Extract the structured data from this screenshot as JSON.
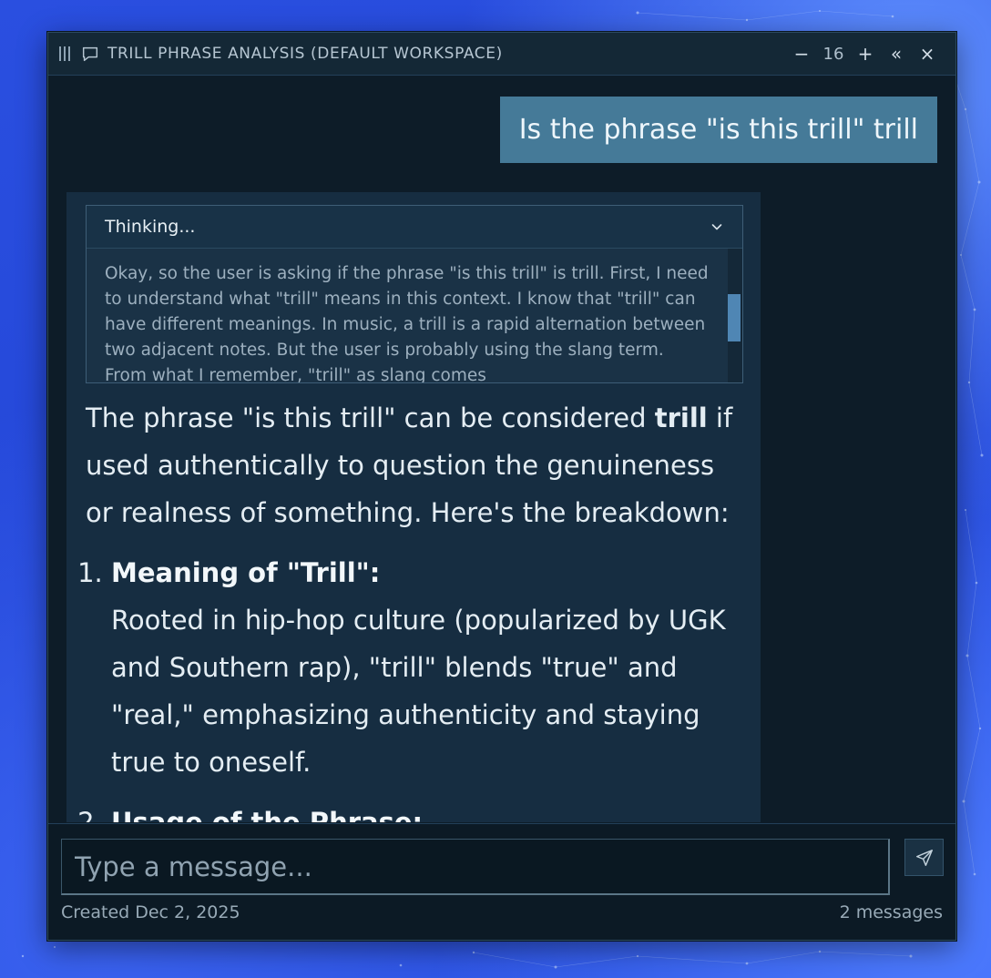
{
  "window": {
    "title": "TRILL PHRASE ANALYSIS (DEFAULT WORKSPACE)",
    "zoom_level": "16",
    "controls": {
      "minimize": "−",
      "zoom_in": "+",
      "collapse": "«",
      "close": "×"
    }
  },
  "user_message": "Is the phrase \"is this trill\" trill",
  "assistant": {
    "thinking": {
      "label": "Thinking...",
      "text": "Okay, so the user is asking if the phrase \"is this trill\" is trill. First, I need to understand what \"trill\" means in this context. I know that \"trill\" can have different meanings. In music, a trill is a rapid alternation between two adjacent notes. But the user is probably using the slang term. From what I remember, \"trill\" as slang comes"
    },
    "answer": {
      "intro_before": "The phrase \"is this trill\" can be considered ",
      "intro_bold": "trill",
      "intro_after": " if used authentically to question the genuineness or realness of something. Here's the breakdown:",
      "items": [
        {
          "heading": "Meaning of \"Trill\":",
          "body": "Rooted in hip-hop culture (popularized by UGK and Southern rap), \"trill\" blends \"true\" and \"real,\" emphasizing authenticity and staying true to oneself."
        },
        {
          "heading": "Usage of the Phrase:",
          "body": ""
        }
      ]
    }
  },
  "composer": {
    "placeholder": "Type a message...",
    "created": "Created Dec 2, 2025",
    "message_count": "2 messages"
  }
}
